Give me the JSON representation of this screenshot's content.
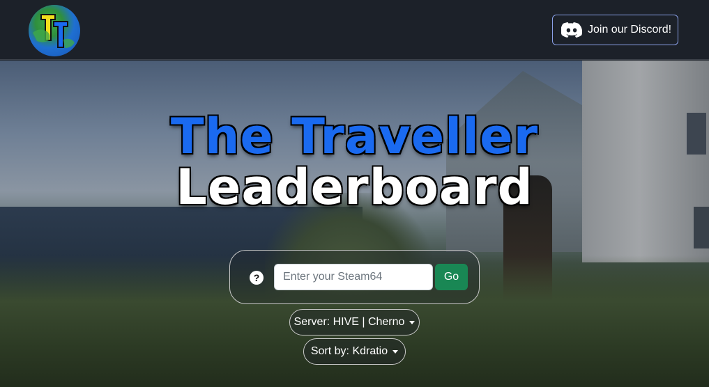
{
  "header": {
    "logo": "tt-globe-logo",
    "discord_label": "Join our Discord!",
    "discord_icon": "discord-icon"
  },
  "hero": {
    "title_line1": "The Traveller",
    "title_line2": "Leaderboard",
    "title_line1_color": "#1a6af0",
    "title_line2_color": "#ffffff"
  },
  "search": {
    "help_glyph": "?",
    "placeholder": "Enter your Steam64",
    "value": "",
    "go_label": "Go",
    "go_color": "#198754"
  },
  "filters": {
    "server_label": "Server: HIVE | Cherno",
    "sort_label": "Sort by: Kdratio"
  }
}
